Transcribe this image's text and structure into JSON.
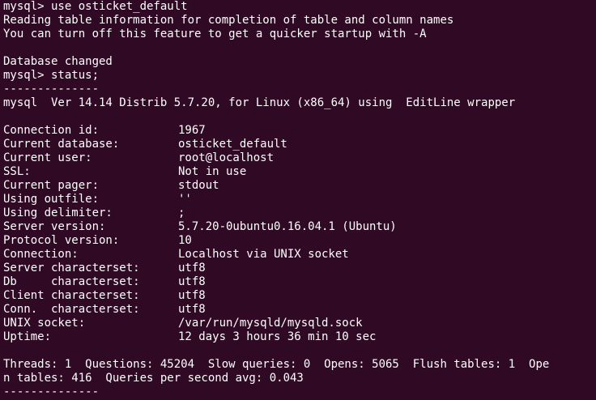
{
  "header_lines": [
    "mysql> use osticket_default",
    "Reading table information for completion of table and column names",
    "You can turn off this feature to get a quicker startup with -A",
    "",
    "Database changed",
    "mysql> status;",
    "--------------",
    "mysql  Ver 14.14 Distrib 5.7.20, for Linux (x86_64) using  EditLine wrapper",
    ""
  ],
  "status_rows": [
    {
      "key": "Connection id:",
      "value": "1967"
    },
    {
      "key": "Current database:",
      "value": "osticket_default"
    },
    {
      "key": "Current user:",
      "value": "root@localhost"
    },
    {
      "key": "SSL:",
      "value": "Not in use"
    },
    {
      "key": "Current pager:",
      "value": "stdout"
    },
    {
      "key": "Using outfile:",
      "value": "''"
    },
    {
      "key": "Using delimiter:",
      "value": ";"
    },
    {
      "key": "Server version:",
      "value": "5.7.20-0ubuntu0.16.04.1 (Ubuntu)"
    },
    {
      "key": "Protocol version:",
      "value": "10"
    },
    {
      "key": "Connection:",
      "value": "Localhost via UNIX socket"
    },
    {
      "key": "Server characterset:",
      "value": "utf8"
    },
    {
      "key": "Db     characterset:",
      "value": "utf8"
    },
    {
      "key": "Client characterset:",
      "value": "utf8"
    },
    {
      "key": "Conn.  characterset:",
      "value": "utf8"
    },
    {
      "key": "UNIX socket:",
      "value": "/var/run/mysqld/mysqld.sock"
    },
    {
      "key": "Uptime:",
      "value": "12 days 3 hours 36 min 10 sec"
    }
  ],
  "footer_lines": [
    "",
    "Threads: 1  Questions: 45204  Slow queries: 0  Opens: 5065  Flush tables: 1  Ope",
    "n tables: 416  Queries per second avg: 0.043",
    "--------------"
  ],
  "colors": {
    "background": "#300a24",
    "foreground": "#ffffff"
  }
}
